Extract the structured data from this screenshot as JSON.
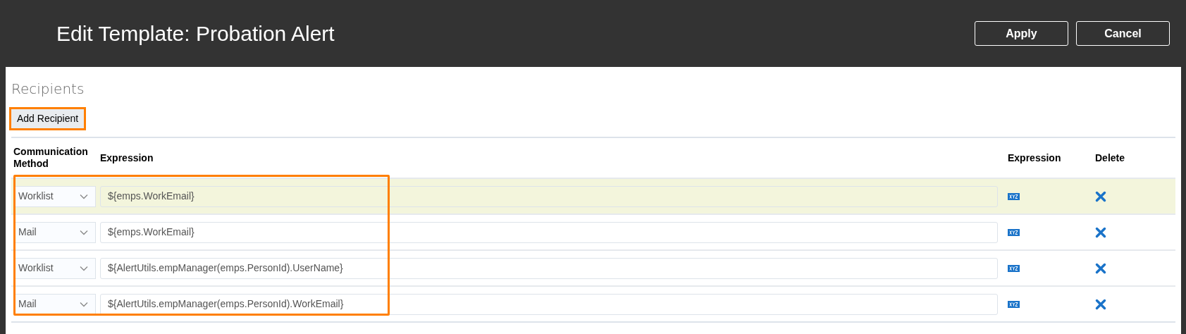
{
  "header": {
    "title": "Edit Template: Probation Alert",
    "buttons": [
      {
        "label": "Apply"
      },
      {
        "label": "Cancel"
      }
    ]
  },
  "section": {
    "title": "Recipients",
    "add_button": {
      "label": "Add Recipient",
      "highlighted": true
    }
  },
  "table": {
    "columns": [
      "Communication Method",
      "Expression",
      "Expression",
      "Delete"
    ],
    "rows_highlighted": true,
    "rows": [
      {
        "method": "Worklist",
        "expression": "${emps.WorkEmail}",
        "selected": true
      },
      {
        "method": "Mail",
        "expression": "${emps.WorkEmail}",
        "selected": false
      },
      {
        "method": "Worklist",
        "expression": "${AlertUtils.empManager(emps.PersonId).UserName}",
        "selected": false
      },
      {
        "method": "Mail",
        "expression": "${AlertUtils.empManager(emps.PersonId).WorkEmail}",
        "selected": false
      }
    ]
  }
}
